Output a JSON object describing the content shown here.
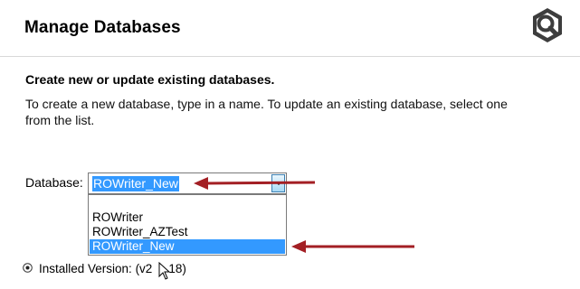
{
  "header": {
    "title": "Manage Databases",
    "icon": "wrench-gear-icon"
  },
  "content": {
    "heading": "Create new or update existing databases.",
    "description": "To create a new database, type in a name. To update an existing database, select one from the list."
  },
  "database": {
    "label": "Database:",
    "value": "ROWriter_New",
    "options": [
      {
        "label": "",
        "selected": false
      },
      {
        "label": "ROWriter",
        "selected": false
      },
      {
        "label": "ROWriter_AZTest",
        "selected": false
      },
      {
        "label": "ROWriter_New",
        "selected": true
      }
    ]
  },
  "installed": {
    "label": "Installed Version: (v2",
    "suffix": "18)"
  },
  "colors": {
    "annotation_arrow": "#a31f24",
    "selection": "#3399ff"
  }
}
